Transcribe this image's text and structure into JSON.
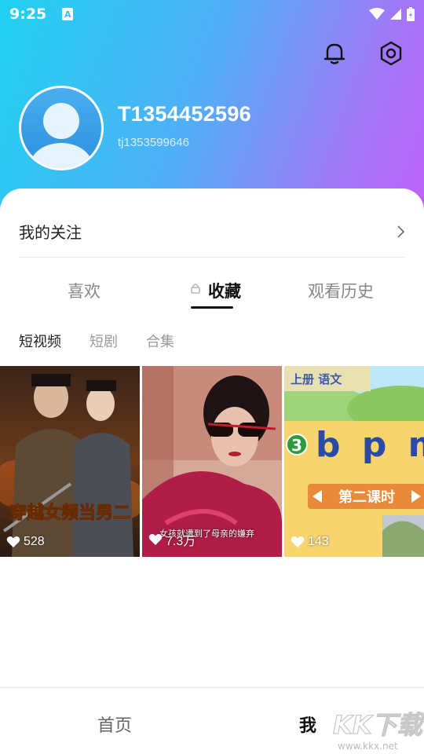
{
  "status_bar": {
    "time": "9:25",
    "notification_icon": "A"
  },
  "header": {
    "bell_icon": "bell-icon",
    "settings_icon": "hexagon-settings-icon"
  },
  "profile": {
    "name": "T1354452596",
    "id": "tj1353599646"
  },
  "follow": {
    "label": "我的关注"
  },
  "tabs": [
    {
      "label": "喜欢"
    },
    {
      "label": "收藏",
      "locked": true
    },
    {
      "label": "观看历史"
    }
  ],
  "subtabs": [
    {
      "label": "短视频"
    },
    {
      "label": "短剧"
    },
    {
      "label": "合集"
    }
  ],
  "videos": [
    {
      "likes": "528",
      "title_text": "穿越女频当男二"
    },
    {
      "likes": "7.3万",
      "caption": "女孩就遭到了母亲的嫌弃"
    },
    {
      "likes": "143",
      "text_top": "上册 语文",
      "letters": "b p m",
      "number": "3",
      "lesson": "第二课时"
    }
  ],
  "bottom_nav": {
    "home": "首页",
    "me": "我"
  },
  "watermark": {
    "text": "KK下载",
    "url": "www.kkx.net"
  },
  "colors": {
    "gradient_start": "#1fd2f0",
    "gradient_end": "#c060f8"
  }
}
